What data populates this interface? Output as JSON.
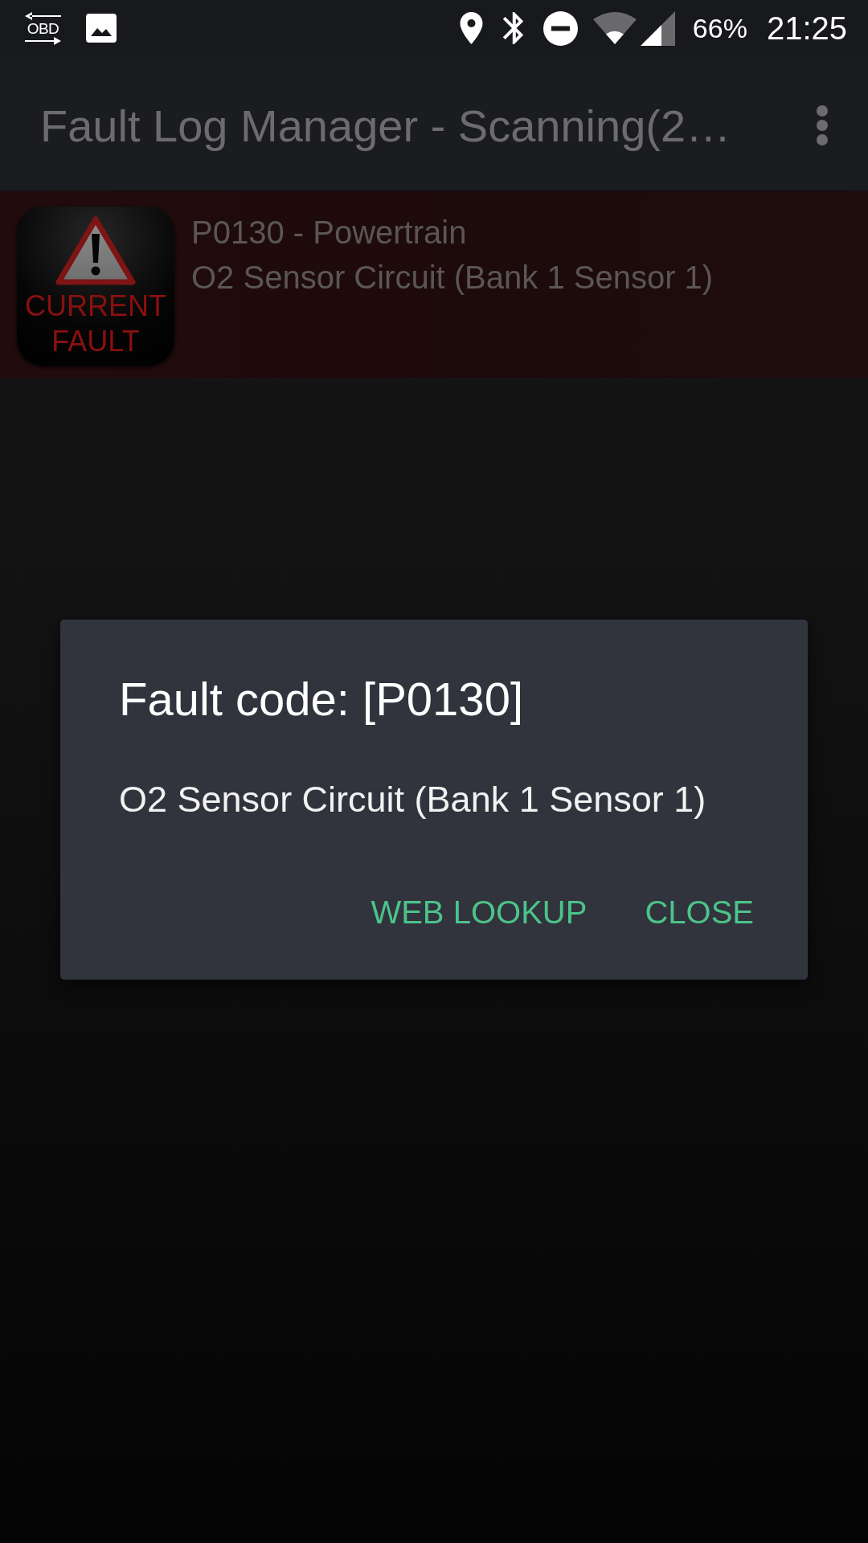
{
  "status_bar": {
    "notification_label": "OBD",
    "battery": "66%",
    "time": "21:25"
  },
  "app_bar": {
    "title": "Fault Log Manager - Scanning(2…"
  },
  "faults": [
    {
      "badge_label": "CURRENT FAULT",
      "code_line": "P0130 - Powertrain",
      "description": "O2 Sensor Circuit (Bank 1 Sensor 1)"
    }
  ],
  "dialog": {
    "title": "Fault code: [P0130]",
    "message": "O2 Sensor Circuit (Bank 1 Sensor 1)",
    "buttons": [
      "WEB LOOKUP",
      "CLOSE"
    ]
  }
}
